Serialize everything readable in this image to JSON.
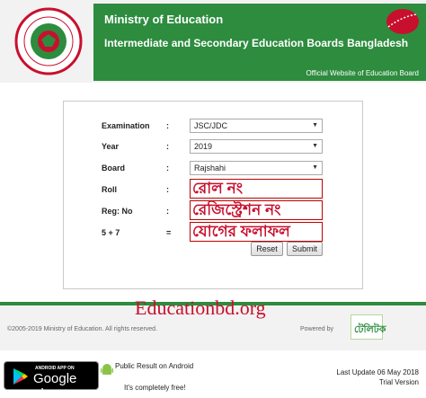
{
  "header": {
    "ministry": "Ministry of Education",
    "boards": "Intermediate and Secondary Education Boards Bangladesh",
    "official": "Official Website of Education Board"
  },
  "form": {
    "examination": {
      "label": "Examination",
      "colon": ":",
      "value": "JSC/JDC"
    },
    "year": {
      "label": "Year",
      "colon": ":",
      "value": "2019"
    },
    "board": {
      "label": "Board",
      "colon": ":",
      "value": "Rajshahi"
    },
    "roll": {
      "label": "Roll",
      "colon": ":",
      "overlay": "রোল নং"
    },
    "reg": {
      "label": "Reg: No",
      "colon": ":",
      "overlay": "রেজিস্ট্রেশন নং"
    },
    "sum": {
      "label": "5 + 7",
      "colon": "=",
      "overlay": "যোগের ফলাফল"
    },
    "reset_label": "Reset",
    "submit_label": "Submit"
  },
  "watermark": "Educationbd.org",
  "footer": {
    "copyright": "©2005-2019 Ministry of Education. All rights reserved.",
    "powered": "Powered by",
    "teletalk": "টেলিটক"
  },
  "bottom": {
    "gplay_small": "ANDROID APP ON",
    "gplay_big": "Google play",
    "public_result": "Public Result on Android",
    "free": "It's completely free!",
    "last_update": "Last Update 06 May 2018",
    "trial": "Trial Version"
  },
  "colors": {
    "brand_green": "#2d8c3e",
    "accent_red": "#c8102e"
  }
}
